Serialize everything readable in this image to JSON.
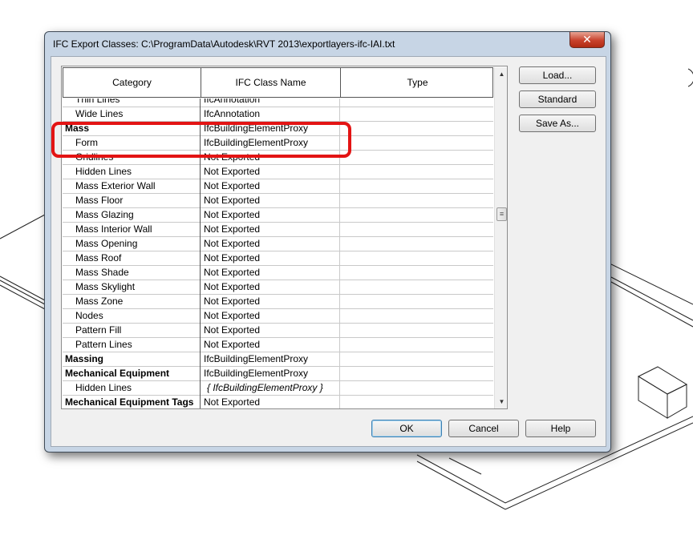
{
  "dialog": {
    "title": "IFC Export Classes: C:\\ProgramData\\Autodesk\\RVT 2013\\exportlayers-ifc-IAI.txt",
    "close_glyph": "✕"
  },
  "table": {
    "columns": [
      "Category",
      "IFC Class Name",
      "Type"
    ],
    "rows": [
      {
        "category": "Thin Lines",
        "ifc": "IfcAnnotation",
        "type": "",
        "level": "child"
      },
      {
        "category": "Wide Lines",
        "ifc": "IfcAnnotation",
        "type": "",
        "level": "child"
      },
      {
        "category": "Mass",
        "ifc": "IfcBuildingElementProxy",
        "type": "",
        "level": "parent"
      },
      {
        "category": "Form",
        "ifc": "IfcBuildingElementProxy",
        "type": "",
        "level": "child"
      },
      {
        "category": "Gridlines",
        "ifc": "Not Exported",
        "type": "",
        "level": "child"
      },
      {
        "category": "Hidden Lines",
        "ifc": "Not Exported",
        "type": "",
        "level": "child"
      },
      {
        "category": "Mass Exterior Wall",
        "ifc": "Not Exported",
        "type": "",
        "level": "child"
      },
      {
        "category": "Mass Floor",
        "ifc": "Not Exported",
        "type": "",
        "level": "child"
      },
      {
        "category": "Mass Glazing",
        "ifc": "Not Exported",
        "type": "",
        "level": "child"
      },
      {
        "category": "Mass Interior Wall",
        "ifc": "Not Exported",
        "type": "",
        "level": "child"
      },
      {
        "category": "Mass Opening",
        "ifc": "Not Exported",
        "type": "",
        "level": "child"
      },
      {
        "category": "Mass Roof",
        "ifc": "Not Exported",
        "type": "",
        "level": "child"
      },
      {
        "category": "Mass Shade",
        "ifc": "Not Exported",
        "type": "",
        "level": "child"
      },
      {
        "category": "Mass Skylight",
        "ifc": "Not Exported",
        "type": "",
        "level": "child"
      },
      {
        "category": "Mass Zone",
        "ifc": "Not Exported",
        "type": "",
        "level": "child"
      },
      {
        "category": "Nodes",
        "ifc": "Not Exported",
        "type": "",
        "level": "child"
      },
      {
        "category": "Pattern Fill",
        "ifc": "Not Exported",
        "type": "",
        "level": "child"
      },
      {
        "category": "Pattern Lines",
        "ifc": "Not Exported",
        "type": "",
        "level": "child"
      },
      {
        "category": "Massing",
        "ifc": "IfcBuildingElementProxy",
        "type": "",
        "level": "parent"
      },
      {
        "category": "Mechanical Equipment",
        "ifc": "IfcBuildingElementProxy",
        "type": "",
        "level": "parent"
      },
      {
        "category": "Hidden Lines",
        "ifc": "{ IfcBuildingElementProxy }",
        "type": "",
        "level": "child",
        "italic": true
      },
      {
        "category": "Mechanical Equipment Tags",
        "ifc": "Not Exported",
        "type": "",
        "level": "parent"
      }
    ]
  },
  "side_buttons": [
    "Load...",
    "Standard",
    "Save As..."
  ],
  "bottom_buttons": [
    "OK",
    "Cancel",
    "Help"
  ],
  "scrollbar": {
    "up_glyph": "▲",
    "down_glyph": "▼",
    "thumb_glyph": "≡",
    "position": 0.42
  },
  "colors": {
    "highlight": "#e31414",
    "close": "#c8422c"
  }
}
